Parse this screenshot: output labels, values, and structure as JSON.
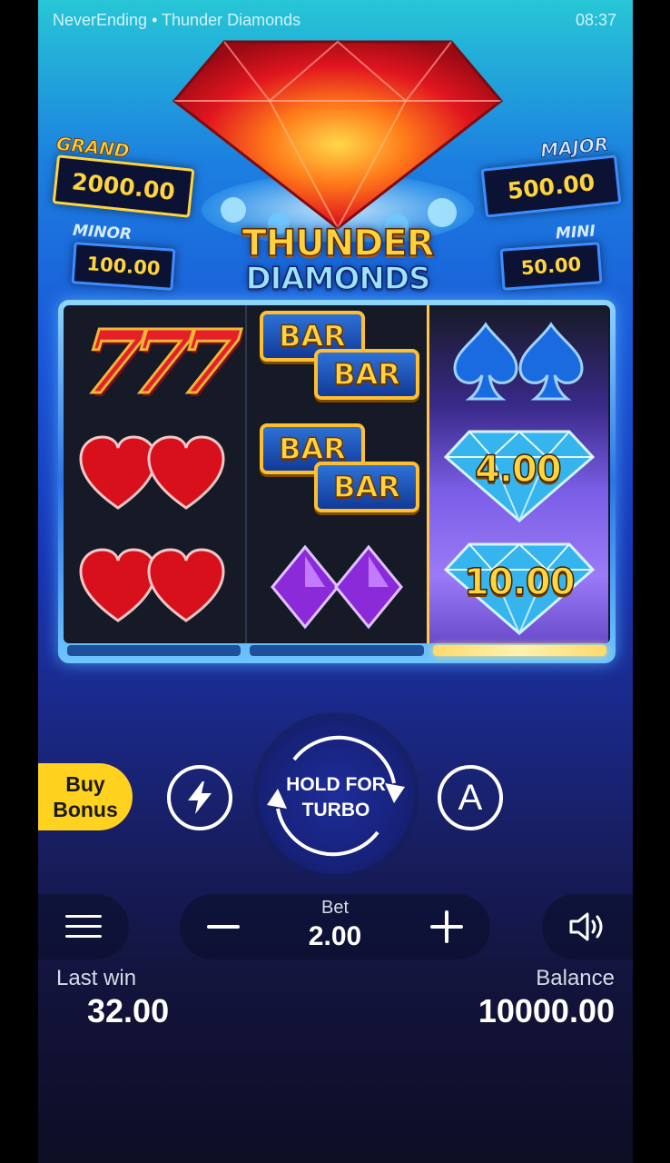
{
  "status_bar": {
    "title": "NeverEnding • Thunder Diamonds",
    "time": "08:37"
  },
  "logo": {
    "line1": "THUNDER",
    "line2": "DIAMONDS"
  },
  "jackpots": {
    "grand": {
      "label": "GRAND",
      "value": "2000.00"
    },
    "major": {
      "label": "MAJOR",
      "value": "500.00"
    },
    "minor": {
      "label": "MINOR",
      "value": "100.00"
    },
    "mini": {
      "label": "MINI",
      "value": "50.00"
    }
  },
  "reels": [
    {
      "symbols": [
        "triple-seven",
        "double-heart",
        "double-heart"
      ],
      "highlighted": false
    },
    {
      "symbols": [
        "double-bar",
        "double-bar",
        "double-diamond-purple"
      ],
      "highlighted": false,
      "bar_text": "BAR"
    },
    {
      "symbols": [
        "double-spade",
        "diamond-value",
        "diamond-value"
      ],
      "highlighted": true,
      "values": [
        "4.00",
        "10.00"
      ]
    }
  ],
  "seven_text": "777",
  "controls": {
    "buy_bonus_line1": "Buy",
    "buy_bonus_line2": "Bonus",
    "spin_line1": "HOLD FOR",
    "spin_line2": "TURBO",
    "auto_label": "A",
    "turbo_icon": "lightning-icon",
    "menu_icon": "hamburger-icon",
    "sound_icon": "speaker-icon"
  },
  "bet": {
    "label": "Bet",
    "value": "2.00"
  },
  "last_win": {
    "label": "Last win",
    "value": "32.00"
  },
  "balance": {
    "label": "Balance",
    "value": "10000.00"
  },
  "colors": {
    "gold": "#ffd43c",
    "buy_bonus": "#ffd21f",
    "panel": "#0c1233"
  }
}
